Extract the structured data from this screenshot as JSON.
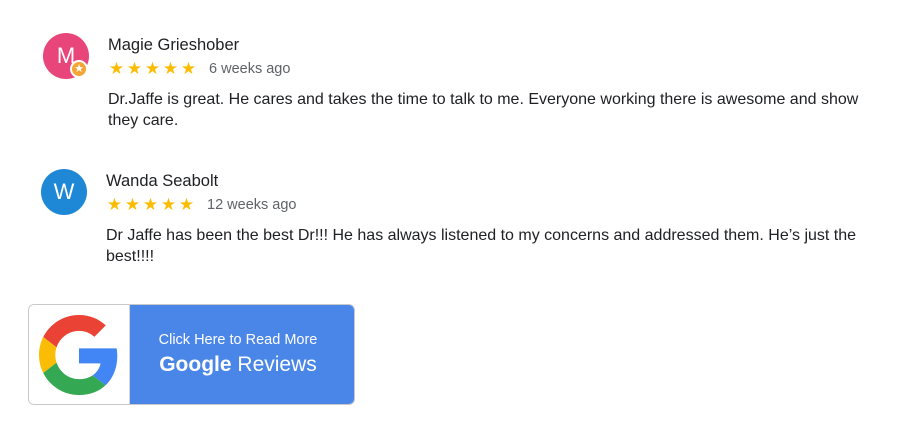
{
  "reviews": [
    {
      "author": "Magie Grieshober",
      "initial": "M",
      "avatar_color": "#e8457a",
      "local_guide_badge": true,
      "rating": 5,
      "stars": "★★★★★",
      "time": "6 weeks ago",
      "text": "Dr.Jaffe is great. He cares and takes the time to talk to me. Everyone working there is awesome and show they care."
    },
    {
      "author": "Wanda Seabolt",
      "initial": "W",
      "avatar_color": "#1f88d6",
      "local_guide_badge": false,
      "rating": 5,
      "stars": "★★★★★",
      "time": "12 weeks ago",
      "text": "Dr Jaffe has been the best Dr!!! He has always listened to my concerns and addressed them. He’s just the best!!!!"
    }
  ],
  "cta": {
    "line1": "Click Here to Read More",
    "brand": "Google",
    "suffix": " Reviews",
    "icon": "google-g-icon",
    "accent": "#4a86e8"
  },
  "colors": {
    "star": "#fbbc04",
    "badge": "#f4a534",
    "meta_text": "#5f6368"
  }
}
